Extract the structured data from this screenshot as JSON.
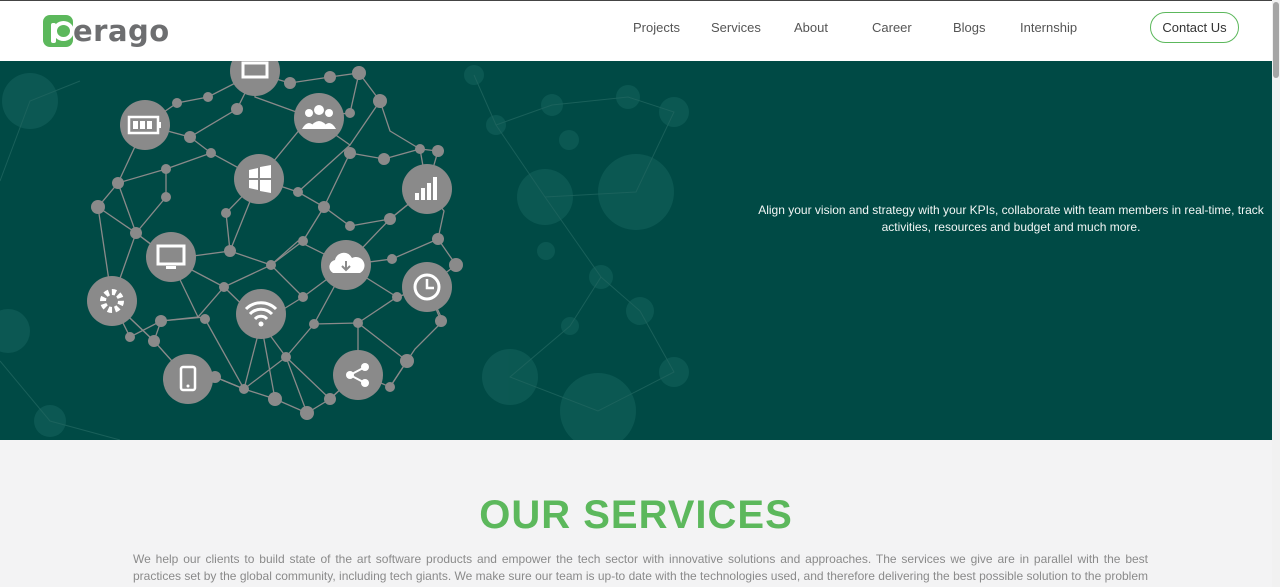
{
  "header": {
    "logo_text": "erago",
    "nav": [
      {
        "label": "Projects"
      },
      {
        "label": "Services"
      },
      {
        "label": "About"
      },
      {
        "label": "Career"
      },
      {
        "label": "Blogs"
      },
      {
        "label": "Internship"
      }
    ],
    "contact_label": "Contact Us"
  },
  "hero": {
    "tagline": "Align your vision and strategy with your KPIs, collaborate with team members in real-time, track activities, resources and budget and much more."
  },
  "services": {
    "title": "OUR SERVICES",
    "description": "We help our clients to build state of the art software products and empower the tech sector with innovative solutions and approaches. The services we give are in parallel with the best practices set by the global community, including tech giants. We make sure our team is up-to date with the technologies used, and therefore delivering the best possible solution to the problem on hand."
  },
  "colors": {
    "brand_green": "#5cb85c",
    "hero_bg": "#004a45",
    "node_grey": "#8a8a8a"
  },
  "icons": [
    "battery-icon",
    "window-icon",
    "users-icon",
    "bar-chart-icon",
    "monitor-icon",
    "cloud-download-icon",
    "clock-icon",
    "gear-icon",
    "wifi-icon",
    "phone-icon",
    "share-icon"
  ]
}
